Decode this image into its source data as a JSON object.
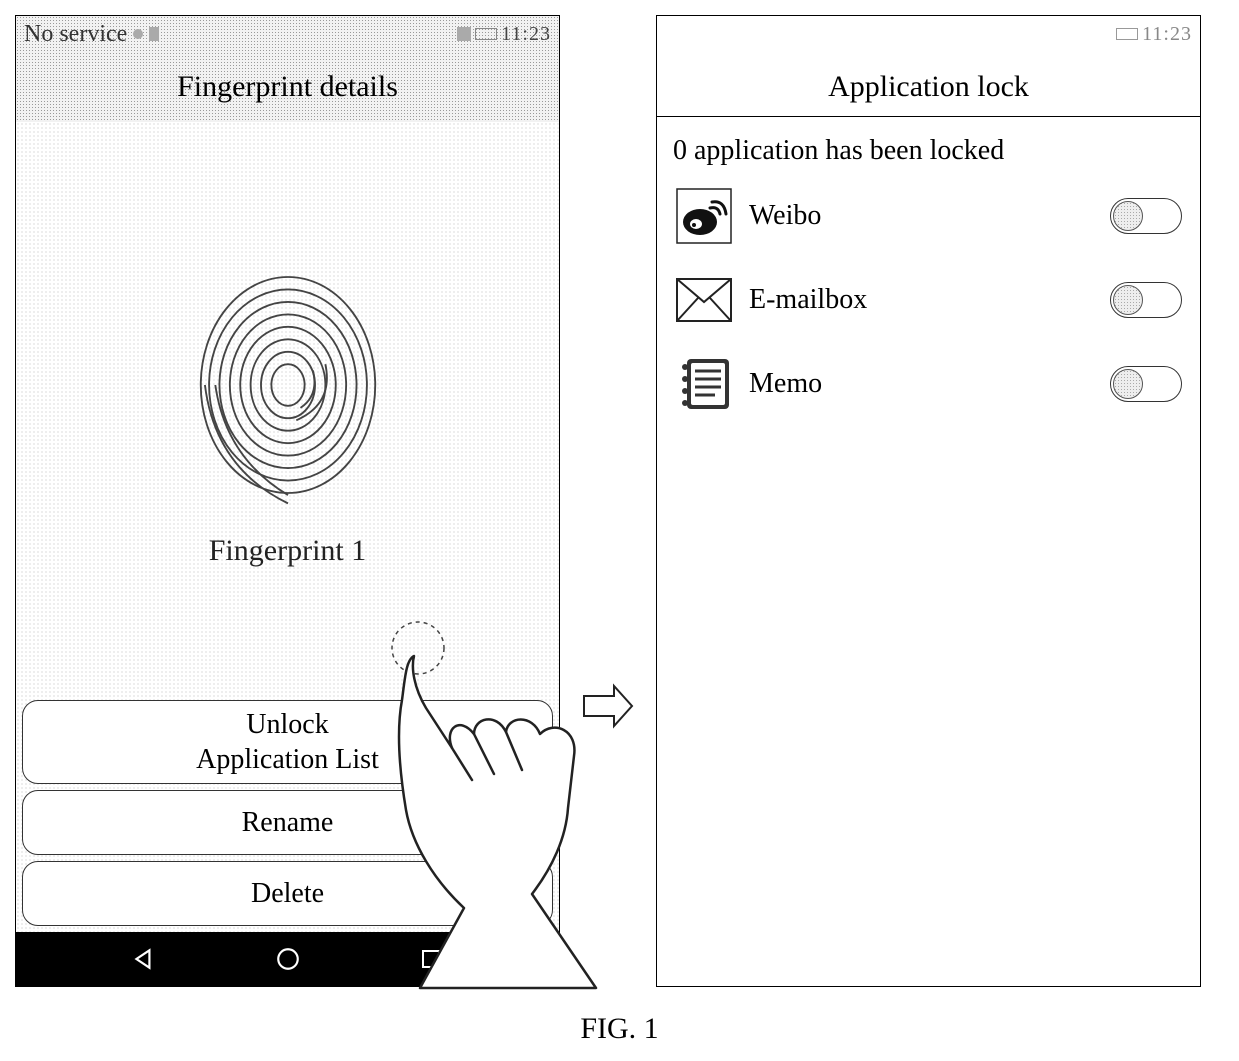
{
  "figure_label": "FIG. 1",
  "left": {
    "status": {
      "service": "No service",
      "time": "11:23"
    },
    "header_title": "Fingerprint details",
    "fingerprint_name": "Fingerprint 1",
    "buttons": {
      "unlock_line1": "Unlock",
      "unlock_line2": "Application List",
      "rename": "Rename",
      "delete": "Delete"
    }
  },
  "right": {
    "status": {
      "time": "11:23"
    },
    "header_title": "Application lock",
    "locked_count_text": "0 application has been locked",
    "apps": [
      {
        "name": "Weibo"
      },
      {
        "name": "E-mailbox"
      },
      {
        "name": "Memo"
      }
    ]
  }
}
